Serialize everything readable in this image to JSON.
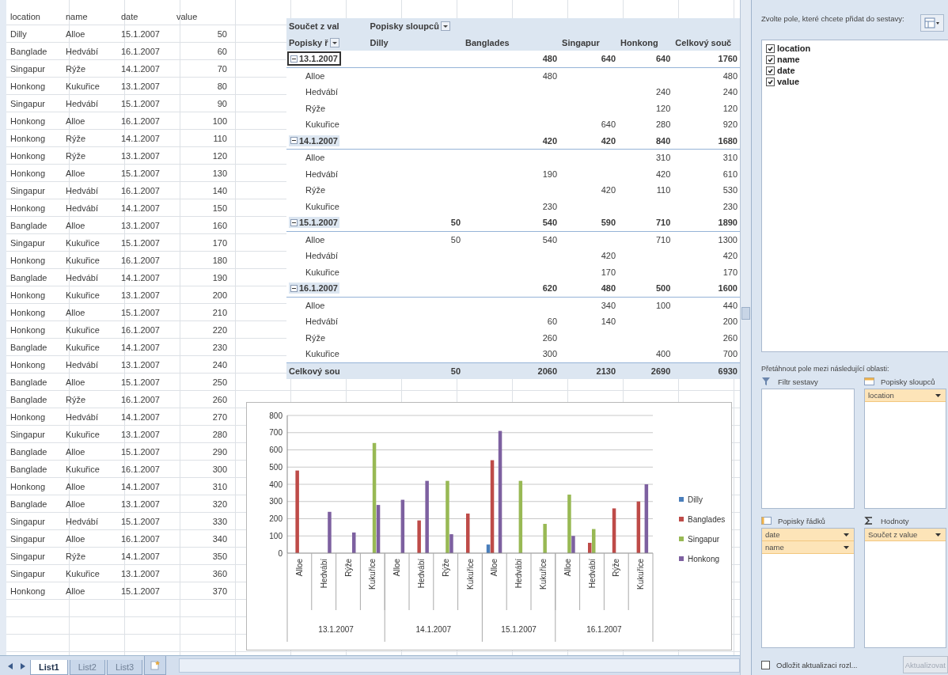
{
  "sheet": {
    "columns": [
      "location",
      "name",
      "date",
      "value"
    ],
    "rows": [
      [
        "Dilly",
        "Alloe",
        "15.1.2007",
        "50"
      ],
      [
        "Banglade",
        "Hedvábí",
        "16.1.2007",
        "60"
      ],
      [
        "Singapur",
        "Rýže",
        "14.1.2007",
        "70"
      ],
      [
        "Honkong",
        "Kukuřice",
        "13.1.2007",
        "80"
      ],
      [
        "Singapur",
        "Hedvábí",
        "15.1.2007",
        "90"
      ],
      [
        "Honkong",
        "Alloe",
        "16.1.2007",
        "100"
      ],
      [
        "Honkong",
        "Rýže",
        "14.1.2007",
        "110"
      ],
      [
        "Honkong",
        "Rýže",
        "13.1.2007",
        "120"
      ],
      [
        "Honkong",
        "Alloe",
        "15.1.2007",
        "130"
      ],
      [
        "Singapur",
        "Hedvábí",
        "16.1.2007",
        "140"
      ],
      [
        "Honkong",
        "Hedvábí",
        "14.1.2007",
        "150"
      ],
      [
        "Banglade",
        "Alloe",
        "13.1.2007",
        "160"
      ],
      [
        "Singapur",
        "Kukuřice",
        "15.1.2007",
        "170"
      ],
      [
        "Honkong",
        "Kukuřice",
        "16.1.2007",
        "180"
      ],
      [
        "Banglade",
        "Hedvábí",
        "14.1.2007",
        "190"
      ],
      [
        "Honkong",
        "Kukuřice",
        "13.1.2007",
        "200"
      ],
      [
        "Honkong",
        "Alloe",
        "15.1.2007",
        "210"
      ],
      [
        "Honkong",
        "Kukuřice",
        "16.1.2007",
        "220"
      ],
      [
        "Banglade",
        "Kukuřice",
        "14.1.2007",
        "230"
      ],
      [
        "Honkong",
        "Hedvábí",
        "13.1.2007",
        "240"
      ],
      [
        "Banglade",
        "Alloe",
        "15.1.2007",
        "250"
      ],
      [
        "Banglade",
        "Rýže",
        "16.1.2007",
        "260"
      ],
      [
        "Honkong",
        "Hedvábí",
        "14.1.2007",
        "270"
      ],
      [
        "Singapur",
        "Kukuřice",
        "13.1.2007",
        "280"
      ],
      [
        "Banglade",
        "Alloe",
        "15.1.2007",
        "290"
      ],
      [
        "Banglade",
        "Kukuřice",
        "16.1.2007",
        "300"
      ],
      [
        "Honkong",
        "Alloe",
        "14.1.2007",
        "310"
      ],
      [
        "Banglade",
        "Alloe",
        "13.1.2007",
        "320"
      ],
      [
        "Singapur",
        "Hedvábí",
        "15.1.2007",
        "330"
      ],
      [
        "Singapur",
        "Alloe",
        "16.1.2007",
        "340"
      ],
      [
        "Singapur",
        "Rýže",
        "14.1.2007",
        "350"
      ],
      [
        "Singapur",
        "Kukuřice",
        "13.1.2007",
        "360"
      ],
      [
        "Honkong",
        "Alloe",
        "15.1.2007",
        "370"
      ]
    ]
  },
  "pivot": {
    "value_label": "Součet z val",
    "column_labels_header": "Popisky sloupců",
    "row_labels_header": "Popisky ř",
    "columns": [
      "Dilly",
      "Banglades",
      "Singapur",
      "Honkong",
      "Celkový souč"
    ],
    "groups": [
      {
        "label": "13.1.2007",
        "expanded": true,
        "selected": true,
        "cells": [
          "",
          "480",
          "640",
          "640",
          "1760"
        ],
        "rows": [
          {
            "label": "Alloe",
            "cells": [
              "",
              "480",
              "",
              "",
              "480"
            ]
          },
          {
            "label": "Hedvábí",
            "cells": [
              "",
              "",
              "",
              "240",
              "240"
            ]
          },
          {
            "label": "Rýže",
            "cells": [
              "",
              "",
              "",
              "120",
              "120"
            ]
          },
          {
            "label": "Kukuřice",
            "cells": [
              "",
              "",
              "640",
              "280",
              "920"
            ]
          }
        ]
      },
      {
        "label": "14.1.2007",
        "expanded": true,
        "selected": false,
        "cells": [
          "",
          "420",
          "420",
          "840",
          "1680"
        ],
        "rows": [
          {
            "label": "Alloe",
            "cells": [
              "",
              "",
              "",
              "310",
              "310"
            ]
          },
          {
            "label": "Hedvábí",
            "cells": [
              "",
              "190",
              "",
              "420",
              "610"
            ]
          },
          {
            "label": "Rýže",
            "cells": [
              "",
              "",
              "420",
              "110",
              "530"
            ]
          },
          {
            "label": "Kukuřice",
            "cells": [
              "",
              "230",
              "",
              "",
              "230"
            ]
          }
        ]
      },
      {
        "label": "15.1.2007",
        "expanded": true,
        "selected": false,
        "cells": [
          "50",
          "540",
          "590",
          "710",
          "1890"
        ],
        "rows": [
          {
            "label": "Alloe",
            "cells": [
              "50",
              "540",
              "",
              "710",
              "1300"
            ]
          },
          {
            "label": "Hedvábí",
            "cells": [
              "",
              "",
              "420",
              "",
              "420"
            ]
          },
          {
            "label": "Kukuřice",
            "cells": [
              "",
              "",
              "170",
              "",
              "170"
            ]
          }
        ]
      },
      {
        "label": "16.1.2007",
        "expanded": true,
        "selected": false,
        "cells": [
          "",
          "620",
          "480",
          "500",
          "1600"
        ],
        "rows": [
          {
            "label": "Alloe",
            "cells": [
              "",
              "",
              "340",
              "100",
              "440"
            ]
          },
          {
            "label": "Hedvábí",
            "cells": [
              "",
              "60",
              "140",
              "",
              "200"
            ]
          },
          {
            "label": "Rýže",
            "cells": [
              "",
              "260",
              "",
              "",
              "260"
            ]
          },
          {
            "label": "Kukuřice",
            "cells": [
              "",
              "300",
              "",
              "400",
              "700"
            ]
          }
        ]
      }
    ],
    "total": {
      "label": "Celkový sou",
      "cells": [
        "50",
        "2060",
        "2130",
        "2690",
        "6930"
      ]
    }
  },
  "chart": {
    "category_groups": [
      {
        "label": "13.1.2007",
        "categories": [
          "Alloe",
          "Hedvábí",
          "Rýže",
          "Kukuřice"
        ]
      },
      {
        "label": "14.1.2007",
        "categories": [
          "Alloe",
          "Hedvábí",
          "Rýže",
          "Kukuřice"
        ]
      },
      {
        "label": "15.1.2007",
        "categories": [
          "Alloe",
          "Hedvábí",
          "Kukuřice"
        ]
      },
      {
        "label": "16.1.2007",
        "categories": [
          "Alloe",
          "Hedvábí",
          "Rýže",
          "Kukuřice"
        ]
      }
    ],
    "chart_data": {
      "type": "bar",
      "grid": true,
      "legend": true,
      "series": [
        {
          "name": "Dilly",
          "color": "#4a7ebb",
          "values": [
            null,
            null,
            null,
            null,
            null,
            null,
            null,
            null,
            50,
            null,
            null,
            null,
            null,
            null,
            null
          ]
        },
        {
          "name": "Banglades",
          "color": "#be4b48",
          "values": [
            480,
            null,
            null,
            null,
            null,
            190,
            null,
            230,
            540,
            null,
            null,
            null,
            60,
            260,
            300
          ]
        },
        {
          "name": "Singapur",
          "color": "#98b954",
          "values": [
            null,
            null,
            null,
            640,
            null,
            null,
            420,
            null,
            null,
            420,
            170,
            340,
            140,
            null,
            null
          ]
        },
        {
          "name": "Honkong",
          "color": "#7d60a0",
          "values": [
            null,
            240,
            120,
            280,
            310,
            420,
            110,
            null,
            710,
            null,
            null,
            100,
            null,
            null,
            400
          ]
        }
      ],
      "ylim": [
        0,
        800
      ],
      "yticks": [
        {
          "value": 0,
          "label": "0"
        },
        {
          "value": 100,
          "label": "100"
        },
        {
          "value": 200,
          "label": "200"
        },
        {
          "value": 300,
          "label": "300"
        },
        {
          "value": 400,
          "label": "400"
        },
        {
          "value": 500,
          "label": "500"
        },
        {
          "value": 600,
          "label": "600"
        },
        {
          "value": 700,
          "label": "700"
        },
        {
          "value": 800,
          "label": "800"
        }
      ]
    }
  },
  "tabs": [
    {
      "label": "List1",
      "selected": true
    },
    {
      "label": "List2",
      "selected": false
    },
    {
      "label": "List3",
      "selected": false
    }
  ],
  "field_list": {
    "prompt": "Zvolte pole, které chcete přidat do sestavy:",
    "fields": [
      {
        "label": "location",
        "checked": true
      },
      {
        "label": "name",
        "checked": true
      },
      {
        "label": "date",
        "checked": true
      },
      {
        "label": "value",
        "checked": true
      }
    ],
    "areas_prompt": "Přetáhnout pole mezi následující oblasti:",
    "areas": [
      {
        "kind": "filter",
        "title": "Filtr sestavy"
      },
      {
        "kind": "columns",
        "title": "Popisky sloupců",
        "items": [
          "location"
        ]
      },
      {
        "kind": "rows",
        "title": "Popisky řádků",
        "items": [
          "date",
          "name"
        ]
      },
      {
        "kind": "values",
        "title": "Hodnoty",
        "items": [
          "Součet z value"
        ]
      }
    ],
    "defer": {
      "label": "Odložit aktualizaci rozl...",
      "checked": false
    },
    "update_button": {
      "label": "Aktualizovat",
      "disabled": true
    }
  }
}
